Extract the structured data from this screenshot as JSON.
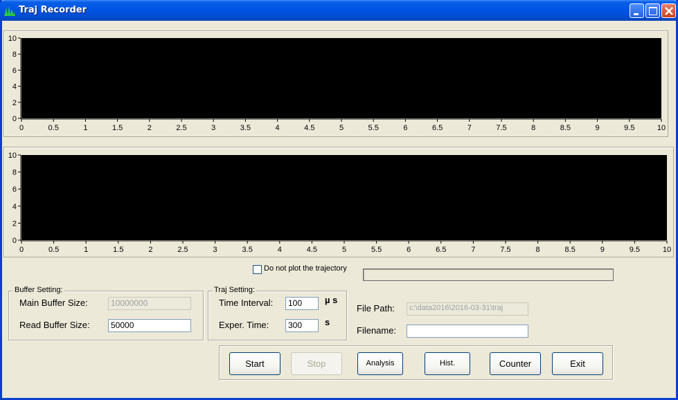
{
  "window": {
    "title": "Traj Recorder",
    "titlebar_color": "#0054e3"
  },
  "plots": [
    {
      "x_ticks": [
        "0",
        "0.5",
        "1",
        "1.5",
        "2",
        "2.5",
        "3",
        "3.5",
        "4",
        "4.5",
        "5",
        "5.5",
        "6",
        "6.5",
        "7",
        "7.5",
        "8",
        "8.5",
        "9",
        "9.5",
        "10"
      ],
      "y_ticks": [
        "0",
        "2",
        "4",
        "6",
        "8",
        "10"
      ],
      "background": "#000000"
    },
    {
      "x_ticks": [
        "0",
        "0.5",
        "1",
        "1.5",
        "2",
        "2.5",
        "3",
        "3.5",
        "4",
        "4.5",
        "5",
        "5.5",
        "6",
        "6.5",
        "7",
        "7.5",
        "8",
        "8.5",
        "9",
        "9.5",
        "10"
      ],
      "y_ticks": [
        "0",
        "2",
        "4",
        "6",
        "8",
        "10"
      ],
      "background": "#000000"
    }
  ],
  "options": {
    "no_plot_label": "Do not plot the trajectory",
    "no_plot_checked": false,
    "progress": 0
  },
  "buffer": {
    "title": "Buffer Setting:",
    "main_label": "Main Buffer Size:",
    "main_value": "10000000",
    "read_label": "Read Buffer Size:",
    "read_value": "50000"
  },
  "traj": {
    "title": "Traj Setting:",
    "interval_label": "Time Interval:",
    "interval_value": "100",
    "interval_unit": "µ s",
    "exper_label": "Exper. Time:",
    "exper_value": "300",
    "exper_unit": "s"
  },
  "file": {
    "path_label": "File Path:",
    "path_value": "c:\\data2016\\2016-03-31\\traj",
    "name_label": "Filename:",
    "name_value": ""
  },
  "buttons": {
    "start": "Start",
    "stop": "Stop",
    "analysis": "Analysis",
    "hist": "Hist.",
    "counter": "Counter",
    "exit": "Exit"
  }
}
